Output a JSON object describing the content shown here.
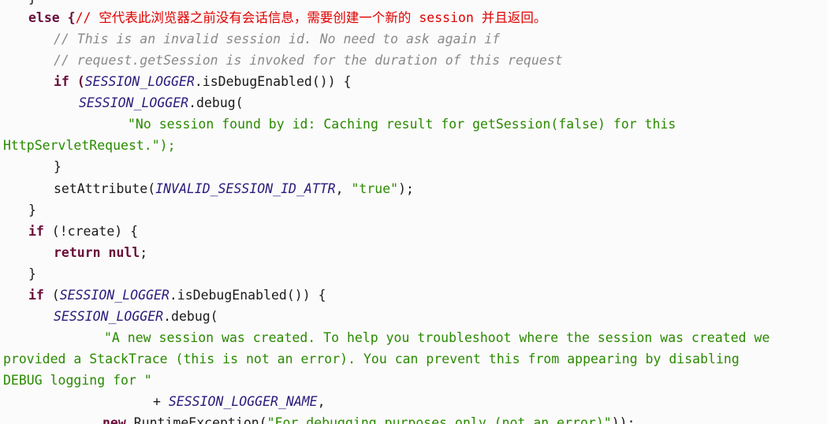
{
  "code": {
    "lines": [
      {
        "tokens": [
          {
            "t": "}",
            "c": "pl"
          }
        ]
      },
      {
        "tokens": [
          {
            "t": "else {",
            "c": "kw"
          },
          {
            "t": "// 空代表此浏览器之前没有会话信息，需要创建一个新的 session 并且返回。",
            "c": "rem"
          }
        ]
      },
      {
        "tokens": [
          {
            "t": "// This is an invalid session id. No need to ask again if",
            "c": "cm"
          }
        ]
      },
      {
        "tokens": [
          {
            "t": "// request.getSession is invoked for the duration of this request",
            "c": "cm"
          }
        ]
      },
      {
        "tokens": [
          {
            "t": "if (",
            "c": "kw"
          },
          {
            "t": "SESSION_LOGGER",
            "c": "cn"
          },
          {
            "t": ".isDebugEnabled()) {",
            "c": "pl"
          }
        ]
      },
      {
        "tokens": [
          {
            "t": "SESSION_LOGGER",
            "c": "cn"
          },
          {
            "t": ".debug(",
            "c": "pl"
          }
        ]
      },
      {
        "tokens": [
          {
            "t": "\"No session found by id: Caching result for getSession(false) for this",
            "c": "str"
          }
        ]
      },
      {
        "tokens": [
          {
            "t": "HttpServletRequest.\");",
            "c": "str"
          }
        ]
      },
      {
        "tokens": [
          {
            "t": "}",
            "c": "pl"
          }
        ]
      },
      {
        "tokens": [
          {
            "t": "setAttribute(",
            "c": "pl"
          },
          {
            "t": "INVALID_SESSION_ID_ATTR",
            "c": "cn"
          },
          {
            "t": ", ",
            "c": "pl"
          },
          {
            "t": "\"true\"",
            "c": "str"
          },
          {
            "t": ");",
            "c": "pl"
          }
        ]
      },
      {
        "tokens": [
          {
            "t": "}",
            "c": "pl"
          }
        ]
      },
      {
        "tokens": [
          {
            "t": "if",
            "c": "kw"
          },
          {
            "t": " (!create) {",
            "c": "pl"
          }
        ]
      },
      {
        "tokens": [
          {
            "t": "return null",
            "c": "kw"
          },
          {
            "t": ";",
            "c": "pl"
          }
        ]
      },
      {
        "tokens": [
          {
            "t": "}",
            "c": "pl"
          }
        ]
      },
      {
        "tokens": [
          {
            "t": "if",
            "c": "kw"
          },
          {
            "t": " (",
            "c": "pl"
          },
          {
            "t": "SESSION_LOGGER",
            "c": "cn"
          },
          {
            "t": ".isDebugEnabled()) {",
            "c": "pl"
          }
        ]
      },
      {
        "tokens": [
          {
            "t": "SESSION_LOGGER",
            "c": "cn"
          },
          {
            "t": ".debug(",
            "c": "pl"
          }
        ]
      },
      {
        "tokens": [
          {
            "t": "\"A new session was created. To help you troubleshoot where the session was created we",
            "c": "str"
          }
        ]
      },
      {
        "tokens": [
          {
            "t": "provided a StackTrace (this is not an error). You can prevent this from appearing by disabling",
            "c": "str"
          }
        ]
      },
      {
        "tokens": [
          {
            "t": "DEBUG logging for \"",
            "c": "str"
          }
        ]
      },
      {
        "tokens": [
          {
            "t": "+ ",
            "c": "pl"
          },
          {
            "t": "SESSION_LOGGER_NAME",
            "c": "cn"
          },
          {
            "t": ",",
            "c": "pl"
          }
        ]
      },
      {
        "tokens": [
          {
            "t": "new",
            "c": "kw"
          },
          {
            "t": " RuntimeException(",
            "c": "pl"
          },
          {
            "t": "\"For debugging purposes only (not an error)\"",
            "c": "str"
          },
          {
            "t": "));",
            "c": "pl"
          }
        ]
      }
    ]
  }
}
